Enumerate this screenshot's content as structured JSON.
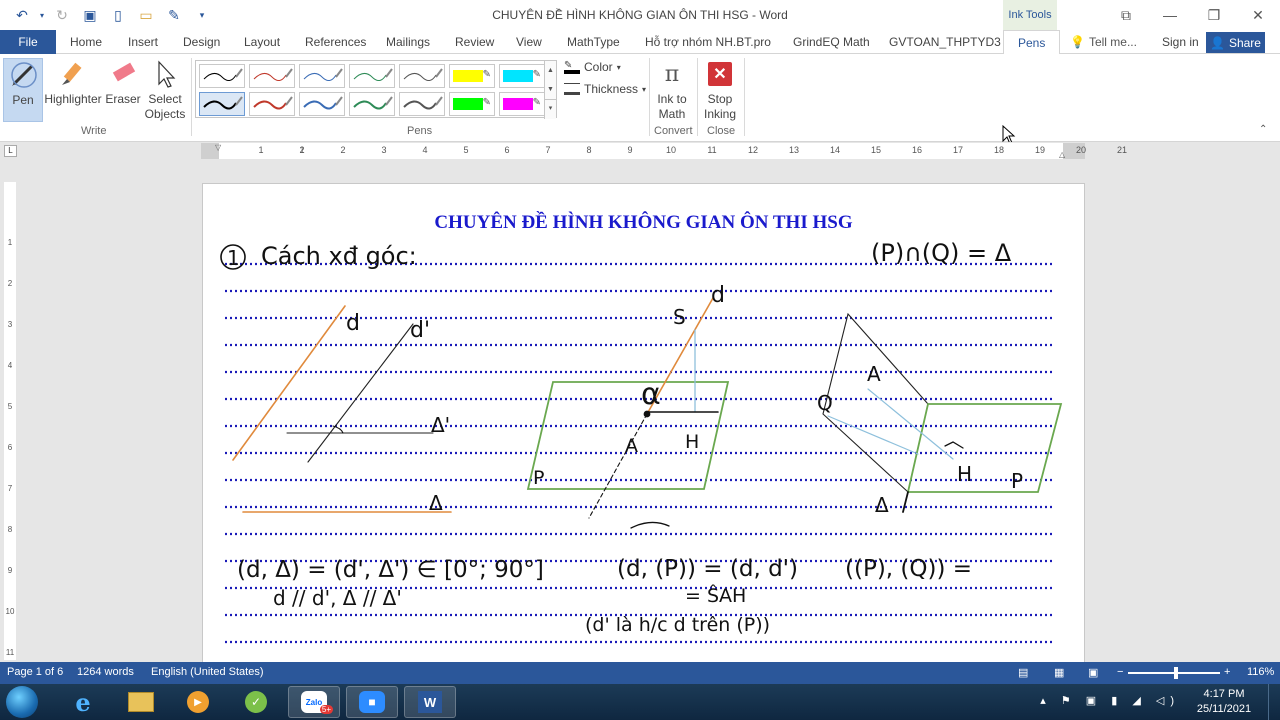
{
  "window": {
    "title": "CHUYÊN ĐỀ HÌNH KHÔNG GIAN ÔN THI HSG - Word",
    "contextual_tab": "Ink Tools"
  },
  "tabs": [
    "File",
    "Home",
    "Insert",
    "Design",
    "Layout",
    "References",
    "Mailings",
    "Review",
    "View",
    "MathType",
    "Hỗ trợ nhóm NH.BT.pro",
    "GrindEQ Math",
    "GVTOAN_THPTYD3",
    "Pens"
  ],
  "tell_me": "Tell me...",
  "sign_in": "Sign in",
  "share": "Share",
  "ribbon": {
    "write": {
      "pen": "Pen",
      "highlighter": "Highlighter",
      "eraser": "Eraser",
      "select_objects": "Select Objects",
      "group": "Write"
    },
    "pens": {
      "group": "Pens",
      "row1": [
        "#000000",
        "#c0392b",
        "#3a6cb5",
        "#2e8b57",
        "#555555",
        "#ffff00",
        "#00e5ff"
      ],
      "row2": [
        "#000000",
        "#c0392b",
        "#3a6cb5",
        "#2e8b57",
        "#555555",
        "#00ff00",
        "#ff00ff"
      ]
    },
    "color_label": "Color",
    "thickness_label": "Thickness",
    "ink_to_math": "Ink to Math",
    "convert_group": "Convert",
    "stop_inking": "Stop Inking",
    "close_group": "Close"
  },
  "ruler_numbers": [
    "2",
    "1",
    "1",
    "2",
    "3",
    "4",
    "5",
    "6",
    "7",
    "8",
    "9",
    "10",
    "11",
    "12",
    "13",
    "14",
    "15",
    "16",
    "17",
    "18",
    "19",
    "20",
    "21"
  ],
  "vruler_numbers": [
    "1",
    "2",
    "3",
    "4",
    "5",
    "6",
    "7",
    "8",
    "9",
    "10",
    "11"
  ],
  "document": {
    "title": "CHUYÊN ĐỀ HÌNH KHÔNG GIAN ÔN THI HSG",
    "ink_text": {
      "heading": "Cách xđ góc:",
      "num": "1",
      "pq": "(P)∩(Q) = Δ",
      "d1": "d",
      "d1p": "d'",
      "delta_p": "Δ'",
      "delta": "Δ",
      "s": "S",
      "d2": "d",
      "a": "A",
      "h": "H",
      "p": "P",
      "alpha": "α",
      "q": "Q",
      "a3": "A",
      "h3": "H",
      "p3": "P",
      "delta3": "Δ",
      "f1": "(d, Δ) = (d', Δ') ∈ [0°; 90°]",
      "f1b": "d // d', Δ // Δ'",
      "f2": "(d, (P)) = (d, d')",
      "f2b": "= ŜAH",
      "f2c": "(d' là h/c d trên (P))",
      "f3": "((P), (Q)) ="
    }
  },
  "status": {
    "page": "Page 1 of 6",
    "words": "1264 words",
    "language": "English (United States)",
    "zoom": "116%"
  },
  "taskbar": {
    "zalo_badge": "5+",
    "time": "4:17 PM",
    "date": "25/11/2021"
  }
}
